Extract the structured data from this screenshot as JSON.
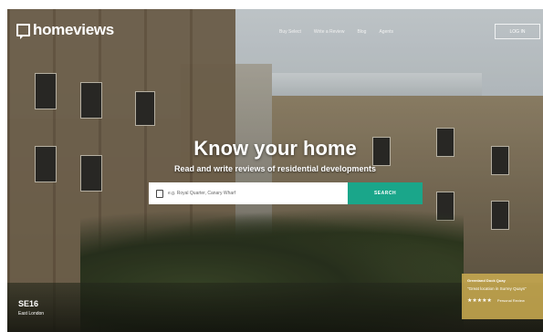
{
  "header": {
    "logo": "homeviews",
    "nav": [
      "Buy Select",
      "Write a Review",
      "Blog",
      "Agents"
    ],
    "login_label": "LOG IN"
  },
  "hero": {
    "title_bold": "Know",
    "title_rest": " your home",
    "subtitle": "Read and write reviews of residential developments",
    "search_placeholder": "e.g. Royal Quarter, Canary Wharf",
    "search_button": "SEARCH"
  },
  "location": {
    "code": "SE16",
    "area": "East London"
  },
  "review": {
    "heading": "Greenland Dock Quay",
    "text": "\"Great location in Surrey Quays\"",
    "stars": "★★★★★",
    "author": "Personal Review"
  },
  "colors": {
    "accent": "#1aa68a",
    "review_card": "#c8aa50"
  },
  "icons": {
    "logo": "speech-bubble-icon",
    "search": "building-icon"
  }
}
